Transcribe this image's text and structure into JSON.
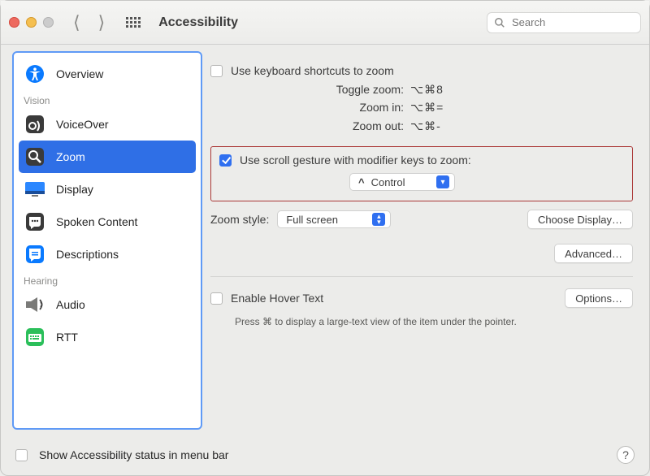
{
  "window": {
    "title": "Accessibility"
  },
  "search": {
    "placeholder": "Search"
  },
  "sidebar": {
    "headings": {
      "vision": "Vision",
      "hearing": "Hearing"
    },
    "items": {
      "overview": {
        "label": "Overview"
      },
      "voiceover": {
        "label": "VoiceOver"
      },
      "zoom": {
        "label": "Zoom"
      },
      "display": {
        "label": "Display"
      },
      "spoken_content": {
        "label": "Spoken Content"
      },
      "descriptions": {
        "label": "Descriptions"
      },
      "audio": {
        "label": "Audio"
      },
      "rtt": {
        "label": "RTT"
      }
    }
  },
  "main": {
    "use_keyboard_shortcuts": {
      "label": "Use keyboard shortcuts to zoom",
      "checked": false
    },
    "shortcuts": {
      "toggle": {
        "label": "Toggle zoom:",
        "keys": "⌥⌘8"
      },
      "in": {
        "label": "Zoom in:",
        "keys": "⌥⌘="
      },
      "out": {
        "label": "Zoom out:",
        "keys": "⌥⌘-"
      }
    },
    "scroll_gesture": {
      "label": "Use scroll gesture with modifier keys to zoom:",
      "checked": true,
      "modifier_prefix": "^",
      "modifier": "Control"
    },
    "zoom_style": {
      "label": "Zoom style:",
      "value": "Full screen",
      "choose_display": "Choose Display…"
    },
    "advanced": "Advanced…",
    "hover_text": {
      "label": "Enable Hover Text",
      "checked": false,
      "options": "Options…",
      "hint": "Press ⌘ to display a large-text view of the item under the pointer."
    }
  },
  "footer": {
    "status_label": "Show Accessibility status in menu bar",
    "checked": false
  }
}
